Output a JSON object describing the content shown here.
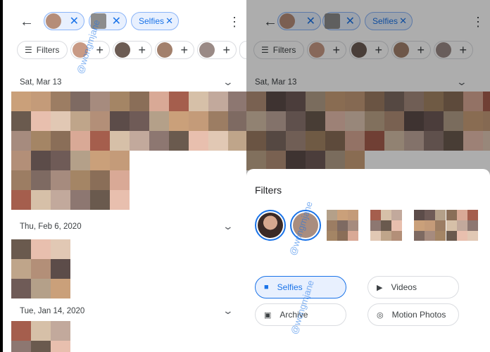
{
  "search_chips": [
    {
      "kind": "person",
      "remove_icon": "close-icon"
    },
    {
      "kind": "person",
      "remove_icon": "close-icon"
    },
    {
      "kind": "type",
      "label": "Selfies",
      "remove_icon": "close-icon"
    }
  ],
  "filters_button": {
    "label": "Filters",
    "icon": "tune-icon"
  },
  "people_suggestions_count": 4,
  "sections": [
    {
      "date": "Sat, Mar 13"
    },
    {
      "date": "Thu, Feb 6, 2020"
    },
    {
      "date": "Tue, Jan 14, 2020"
    }
  ],
  "filters_sheet": {
    "title": "Filters",
    "types": [
      {
        "label": "Selfies",
        "icon": "selfie-icon",
        "selected": true
      },
      {
        "label": "Videos",
        "icon": "play-icon",
        "selected": false
      },
      {
        "label": "Archive",
        "icon": "archive-icon",
        "selected": false
      },
      {
        "label": "Motion Photos",
        "icon": "motion-photo-icon",
        "selected": false
      }
    ]
  },
  "watermark": "@wongmjane",
  "colors": {
    "accent": "#1a73e8",
    "chip_bg": "#e8f0fe",
    "border": "#dadce0"
  }
}
